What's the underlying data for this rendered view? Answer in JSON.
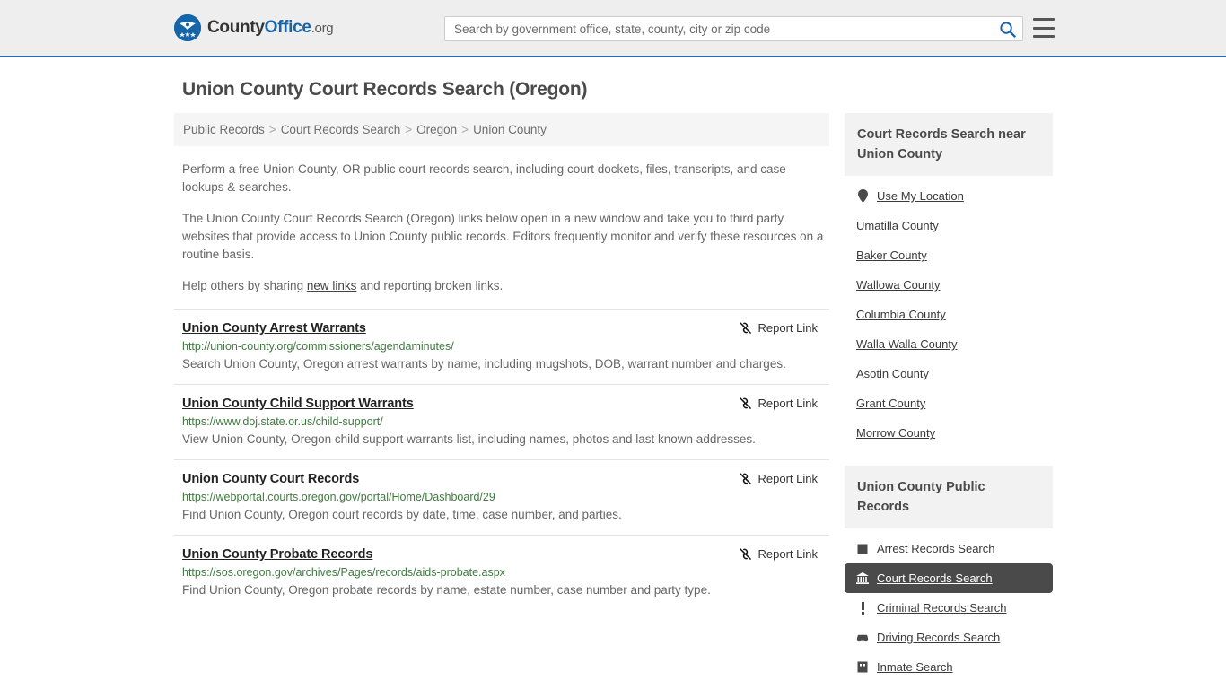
{
  "header": {
    "logo": {
      "part1": "County",
      "part2": "Office",
      "part3": ".org"
    },
    "search": {
      "placeholder": "Search by government office, state, county, city or zip code",
      "value": "",
      "search_icon": "search-icon",
      "menu_icon": "hamburger-menu-icon"
    }
  },
  "page": {
    "title": "Union County Court Records Search (Oregon)"
  },
  "breadcrumb": {
    "items": [
      {
        "label": "Public Records"
      },
      {
        "label": "Court Records Search"
      },
      {
        "label": "Oregon"
      },
      {
        "label": "Union County"
      }
    ],
    "separator": ">"
  },
  "intro": {
    "p1": "Perform a free Union County, OR public court records search, including court dockets, files, transcripts, and case lookups & searches.",
    "p2": "The Union County Court Records Search (Oregon) links below open in a new window and take you to third party websites that provide access to Union County public records. Editors frequently monitor and verify these resources on a routine basis.",
    "p3_before": "Help others by sharing ",
    "p3_link": "new links",
    "p3_after": " and reporting broken links."
  },
  "results": {
    "report_label": "Report Link",
    "report_icon": "broken-link-icon",
    "items": [
      {
        "title": "Union County Arrest Warrants",
        "url": "http://union-county.org/commissioners/agendaminutes/",
        "description": "Search Union County, Oregon arrest warrants by name, including mugshots, DOB, warrant number and charges."
      },
      {
        "title": "Union County Child Support Warrants",
        "url": "https://www.doj.state.or.us/child-support/",
        "description": "View Union County, Oregon child support warrants list, including names, photos and last known addresses."
      },
      {
        "title": "Union County Court Records",
        "url": "https://webportal.courts.oregon.gov/portal/Home/Dashboard/29",
        "description": "Find Union County, Oregon court records by date, time, case number, and parties."
      },
      {
        "title": "Union County Probate Records",
        "url": "https://sos.oregon.gov/archives/Pages/records/aids-probate.aspx",
        "description": "Find Union County, Oregon probate records by name, estate number, case number and party type."
      }
    ]
  },
  "sidebar": {
    "nearby": {
      "title": "Court Records Search near Union County",
      "items": [
        {
          "label": "Use My Location",
          "icon": "map-pin-icon"
        },
        {
          "label": "Umatilla County",
          "icon": ""
        },
        {
          "label": "Baker County",
          "icon": ""
        },
        {
          "label": "Wallowa County",
          "icon": ""
        },
        {
          "label": "Columbia County",
          "icon": ""
        },
        {
          "label": "Walla Walla County",
          "icon": ""
        },
        {
          "label": "Asotin County",
          "icon": ""
        },
        {
          "label": "Grant County",
          "icon": ""
        },
        {
          "label": "Morrow County",
          "icon": ""
        }
      ]
    },
    "public_records": {
      "title": "Union County Public Records",
      "items": [
        {
          "label": "Arrest Records Search",
          "icon": "book-icon",
          "active": false
        },
        {
          "label": "Court Records Search",
          "icon": "courthouse-icon",
          "active": true
        },
        {
          "label": "Criminal Records Search",
          "icon": "exclamation-icon",
          "active": false
        },
        {
          "label": "Driving Records Search",
          "icon": "car-icon",
          "active": false
        },
        {
          "label": "Inmate Search",
          "icon": "building-icon",
          "active": false
        }
      ]
    }
  },
  "colors": {
    "brand_blue": "#1565a8",
    "header_bg": "#eeeeee",
    "url_green": "#3f7a3f",
    "active_bg": "#4a4a4a"
  }
}
